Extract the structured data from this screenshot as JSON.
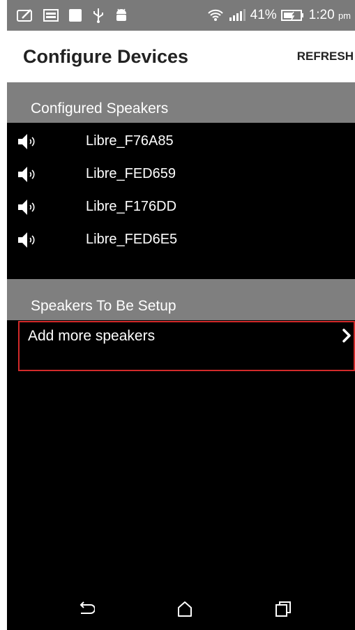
{
  "status_bar": {
    "battery": "41%",
    "time": "1:20",
    "time_suffix": "pm"
  },
  "app_bar": {
    "title": "Configure Devices",
    "refresh_label": "REFRESH"
  },
  "configured": {
    "header": "Configured Speakers",
    "speakers": [
      {
        "name": "Libre_F76A85"
      },
      {
        "name": "Libre_FED659"
      },
      {
        "name": "Libre_F176DD"
      },
      {
        "name": "Libre_FED6E5"
      }
    ]
  },
  "setup": {
    "header": "Speakers To Be Setup",
    "add_label": "Add more speakers"
  },
  "colors": {
    "status_bar": "#7a7a7a",
    "section_header": "#7f7f7f",
    "highlight_border": "#d22a2a",
    "background": "#000000"
  },
  "icons": [
    "edit-icon",
    "image-icon",
    "square-icon",
    "usb-icon",
    "android-icon",
    "wifi-icon",
    "signal-icon",
    "battery-icon",
    "speaker-icon",
    "chevron-right-icon",
    "back-icon",
    "home-icon",
    "recent-apps-icon"
  ]
}
